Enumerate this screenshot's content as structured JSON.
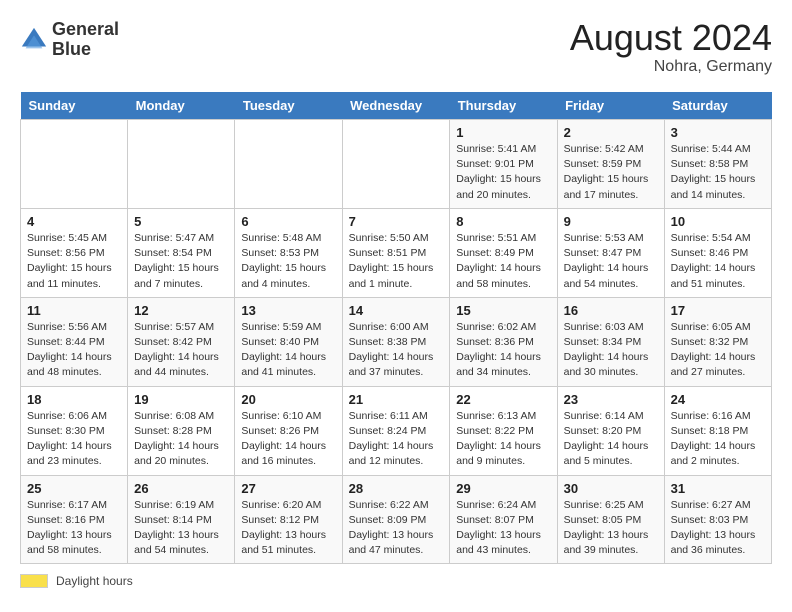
{
  "header": {
    "logo_line1": "General",
    "logo_line2": "Blue",
    "month_year": "August 2024",
    "location": "Nohra, Germany"
  },
  "footer": {
    "swatch_label": "Daylight hours"
  },
  "days_of_week": [
    "Sunday",
    "Monday",
    "Tuesday",
    "Wednesday",
    "Thursday",
    "Friday",
    "Saturday"
  ],
  "weeks": [
    [
      {
        "num": "",
        "info": ""
      },
      {
        "num": "",
        "info": ""
      },
      {
        "num": "",
        "info": ""
      },
      {
        "num": "",
        "info": ""
      },
      {
        "num": "1",
        "info": "Sunrise: 5:41 AM\nSunset: 9:01 PM\nDaylight: 15 hours and 20 minutes."
      },
      {
        "num": "2",
        "info": "Sunrise: 5:42 AM\nSunset: 8:59 PM\nDaylight: 15 hours and 17 minutes."
      },
      {
        "num": "3",
        "info": "Sunrise: 5:44 AM\nSunset: 8:58 PM\nDaylight: 15 hours and 14 minutes."
      }
    ],
    [
      {
        "num": "4",
        "info": "Sunrise: 5:45 AM\nSunset: 8:56 PM\nDaylight: 15 hours and 11 minutes."
      },
      {
        "num": "5",
        "info": "Sunrise: 5:47 AM\nSunset: 8:54 PM\nDaylight: 15 hours and 7 minutes."
      },
      {
        "num": "6",
        "info": "Sunrise: 5:48 AM\nSunset: 8:53 PM\nDaylight: 15 hours and 4 minutes."
      },
      {
        "num": "7",
        "info": "Sunrise: 5:50 AM\nSunset: 8:51 PM\nDaylight: 15 hours and 1 minute."
      },
      {
        "num": "8",
        "info": "Sunrise: 5:51 AM\nSunset: 8:49 PM\nDaylight: 14 hours and 58 minutes."
      },
      {
        "num": "9",
        "info": "Sunrise: 5:53 AM\nSunset: 8:47 PM\nDaylight: 14 hours and 54 minutes."
      },
      {
        "num": "10",
        "info": "Sunrise: 5:54 AM\nSunset: 8:46 PM\nDaylight: 14 hours and 51 minutes."
      }
    ],
    [
      {
        "num": "11",
        "info": "Sunrise: 5:56 AM\nSunset: 8:44 PM\nDaylight: 14 hours and 48 minutes."
      },
      {
        "num": "12",
        "info": "Sunrise: 5:57 AM\nSunset: 8:42 PM\nDaylight: 14 hours and 44 minutes."
      },
      {
        "num": "13",
        "info": "Sunrise: 5:59 AM\nSunset: 8:40 PM\nDaylight: 14 hours and 41 minutes."
      },
      {
        "num": "14",
        "info": "Sunrise: 6:00 AM\nSunset: 8:38 PM\nDaylight: 14 hours and 37 minutes."
      },
      {
        "num": "15",
        "info": "Sunrise: 6:02 AM\nSunset: 8:36 PM\nDaylight: 14 hours and 34 minutes."
      },
      {
        "num": "16",
        "info": "Sunrise: 6:03 AM\nSunset: 8:34 PM\nDaylight: 14 hours and 30 minutes."
      },
      {
        "num": "17",
        "info": "Sunrise: 6:05 AM\nSunset: 8:32 PM\nDaylight: 14 hours and 27 minutes."
      }
    ],
    [
      {
        "num": "18",
        "info": "Sunrise: 6:06 AM\nSunset: 8:30 PM\nDaylight: 14 hours and 23 minutes."
      },
      {
        "num": "19",
        "info": "Sunrise: 6:08 AM\nSunset: 8:28 PM\nDaylight: 14 hours and 20 minutes."
      },
      {
        "num": "20",
        "info": "Sunrise: 6:10 AM\nSunset: 8:26 PM\nDaylight: 14 hours and 16 minutes."
      },
      {
        "num": "21",
        "info": "Sunrise: 6:11 AM\nSunset: 8:24 PM\nDaylight: 14 hours and 12 minutes."
      },
      {
        "num": "22",
        "info": "Sunrise: 6:13 AM\nSunset: 8:22 PM\nDaylight: 14 hours and 9 minutes."
      },
      {
        "num": "23",
        "info": "Sunrise: 6:14 AM\nSunset: 8:20 PM\nDaylight: 14 hours and 5 minutes."
      },
      {
        "num": "24",
        "info": "Sunrise: 6:16 AM\nSunset: 8:18 PM\nDaylight: 14 hours and 2 minutes."
      }
    ],
    [
      {
        "num": "25",
        "info": "Sunrise: 6:17 AM\nSunset: 8:16 PM\nDaylight: 13 hours and 58 minutes."
      },
      {
        "num": "26",
        "info": "Sunrise: 6:19 AM\nSunset: 8:14 PM\nDaylight: 13 hours and 54 minutes."
      },
      {
        "num": "27",
        "info": "Sunrise: 6:20 AM\nSunset: 8:12 PM\nDaylight: 13 hours and 51 minutes."
      },
      {
        "num": "28",
        "info": "Sunrise: 6:22 AM\nSunset: 8:09 PM\nDaylight: 13 hours and 47 minutes."
      },
      {
        "num": "29",
        "info": "Sunrise: 6:24 AM\nSunset: 8:07 PM\nDaylight: 13 hours and 43 minutes."
      },
      {
        "num": "30",
        "info": "Sunrise: 6:25 AM\nSunset: 8:05 PM\nDaylight: 13 hours and 39 minutes."
      },
      {
        "num": "31",
        "info": "Sunrise: 6:27 AM\nSunset: 8:03 PM\nDaylight: 13 hours and 36 minutes."
      }
    ]
  ]
}
